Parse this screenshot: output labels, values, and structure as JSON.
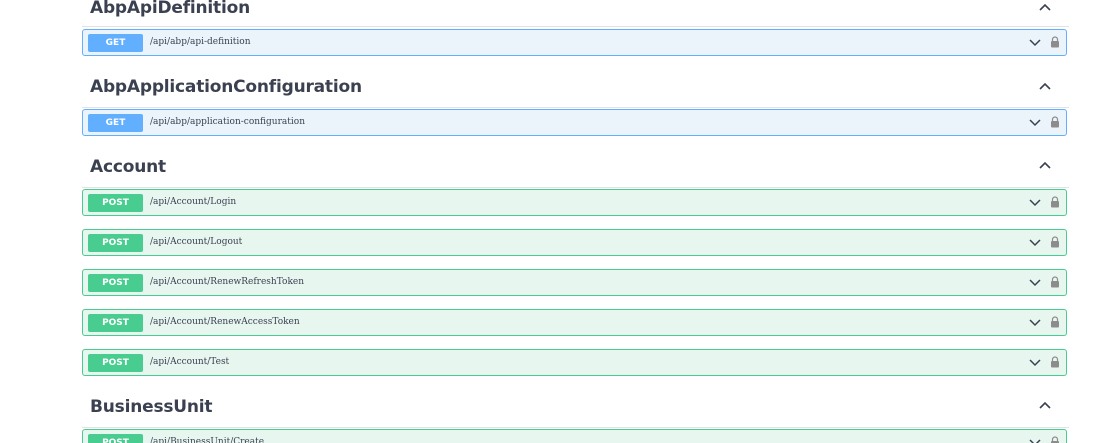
{
  "sections": [
    {
      "title": "AbpApiDefinition",
      "operations": [
        {
          "method": "GET",
          "path": "/api/abp/api-definition"
        }
      ]
    },
    {
      "title": "AbpApplicationConfiguration",
      "operations": [
        {
          "method": "GET",
          "path": "/api/abp/application-configuration"
        }
      ]
    },
    {
      "title": "Account",
      "operations": [
        {
          "method": "POST",
          "path": "/api/Account/Login"
        },
        {
          "method": "POST",
          "path": "/api/Account/Logout"
        },
        {
          "method": "POST",
          "path": "/api/Account/RenewRefreshToken"
        },
        {
          "method": "POST",
          "path": "/api/Account/RenewAccessToken"
        },
        {
          "method": "POST",
          "path": "/api/Account/Test"
        }
      ]
    },
    {
      "title": "BusinessUnit",
      "operations": [
        {
          "method": "POST",
          "path": "/api/BusinessUnit/Create"
        }
      ]
    }
  ],
  "colors": {
    "get": "#61affe",
    "post": "#49cc90",
    "get_bg": "#ebf3fb",
    "post_bg": "#e8f6f0",
    "title": "#3b4151"
  },
  "icons": {
    "collapse": "chevron-up-icon",
    "expand": "chevron-down-icon",
    "auth": "lock-icon"
  }
}
